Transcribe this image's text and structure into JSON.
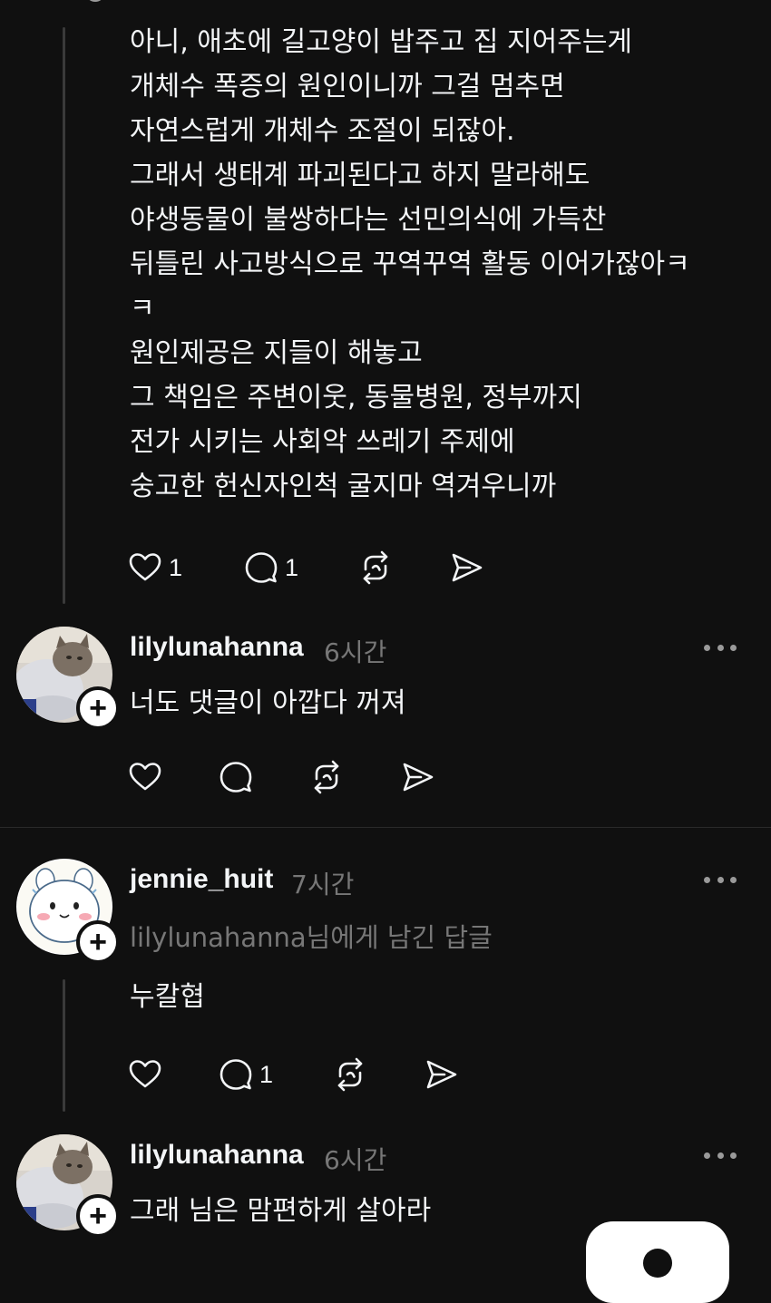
{
  "post1": {
    "text": "아니, 애초에 길고양이 밥주고 집 지어주는게\n개체수 폭증의 원인이니까 그걸 멈추면\n자연스럽게 개체수 조절이 되잖아.\n그래서 생태계 파괴된다고 하지 말라해도\n야생동물이 불쌍하다는 선민의식에 가득찬\n뒤틀린 사고방식으로 꾸역꾸역 활동 이어가잖아ㅋ\nㅋ\n원인제공은 지들이 해놓고\n그 책임은 주변이웃, 동물병원, 정부까지\n전가 시키는 사회악 쓰레기 주제에\n숭고한 헌신자인척 굴지마 역겨우니까",
    "like_count": "1",
    "reply_count": "1"
  },
  "comment1": {
    "username": "lilylunahanna",
    "time": "6시간",
    "text": "너도 댓글이 아깝다 꺼져"
  },
  "comment2": {
    "username": "jennie_huit",
    "time": "7시간",
    "reply_to": "lilylunahanna님에게 남긴 답글",
    "text": "누칼협",
    "reply_count": "1"
  },
  "comment3": {
    "username": "lilylunahanna",
    "time": "6시간",
    "text": "그래 님은 맘편하게 살아라"
  },
  "icons": {
    "like": "heart-icon",
    "reply": "speech-bubble-icon",
    "repost": "repost-icon",
    "share": "paper-plane-icon",
    "more": "more-horizontal-icon",
    "follow": "plus-icon"
  },
  "colors": {
    "background": "#101010",
    "text": "#f3f5f7",
    "muted": "#777777",
    "thread_line": "#3a3a3a"
  }
}
